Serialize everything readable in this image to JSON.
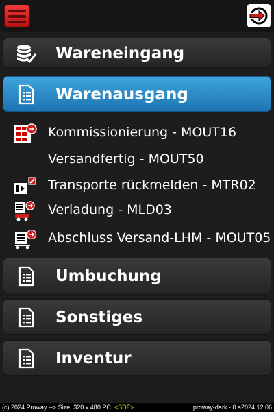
{
  "topbar": {
    "menu_icon": "hamburger-icon",
    "logout_icon": "logout-icon"
  },
  "menu": [
    {
      "label": "Wareneingang",
      "icon": "database-check-icon"
    },
    {
      "label": "Warenausgang",
      "icon": "document-list-icon"
    },
    {
      "label": "Umbuchung",
      "icon": "document-list-icon"
    },
    {
      "label": "Sonstiges",
      "icon": "document-list-icon"
    },
    {
      "label": "Inventur",
      "icon": "document-list-icon"
    }
  ],
  "submenu": [
    {
      "label": "Kommissionierung - MOUT16",
      "icon": "shelf-logout-icon"
    },
    {
      "label": "Versandfertig - MOUT50",
      "icon": ""
    },
    {
      "label": "Transporte rückmelden - MTR02",
      "icon": "transport-edit-icon"
    },
    {
      "label": "Verladung - MLD03",
      "icon": "truck-load-icon"
    },
    {
      "label": "Abschluss Versand-LHM - MOUT05",
      "icon": "cart-close-icon"
    }
  ],
  "footer": {
    "left": "(c) 2024 Proway --> Size: 320 x 480  PC",
    "sde": "<SDE>",
    "right": "proway-dark - 0.a2024.12.06"
  },
  "colors": {
    "active": "#2a8ccb",
    "accent_red": "#d11c1c"
  }
}
